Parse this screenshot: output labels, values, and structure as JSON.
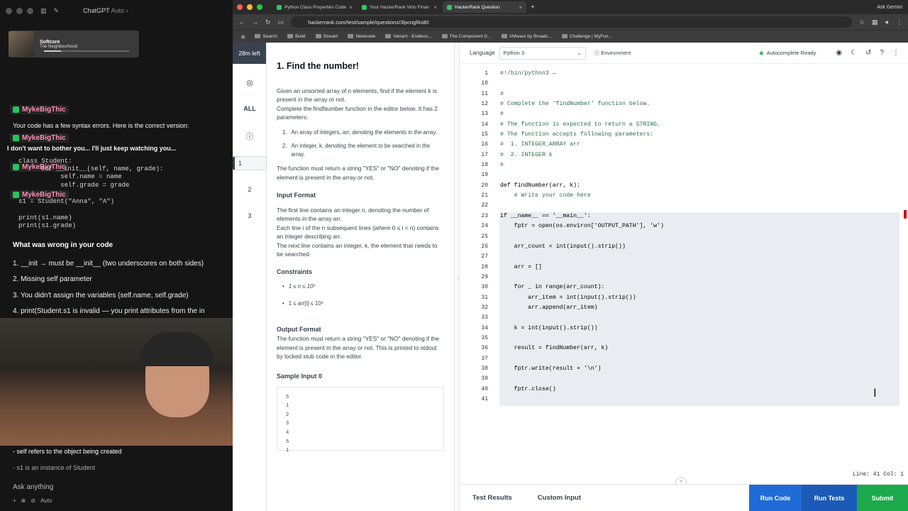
{
  "chatgpt": {
    "title": "ChatGPT",
    "title_suffix": "Auto ›",
    "now_playing": {
      "track": "Softcore",
      "artist": "The Neighbourhood"
    },
    "messages": [
      {
        "user": "MykeBigThic",
        "text": "Your code has a few syntax errors. Here is the correct version:"
      },
      {
        "user": "MykeBigThic",
        "text": "I don't want to bother you... I'll just keep watching you..."
      },
      {
        "user": "MykeBigThic",
        "text": ""
      },
      {
        "user": "MykeBigThic",
        "text": ""
      }
    ],
    "code_lines": [
      "class Student:",
      "    def __init__(self, name, grade):",
      "        self.name = name",
      "        self.grade = grade",
      "s1 = Student(\"Anna\", \"A\")",
      "print(s1.name)",
      "print(s1.grade)"
    ],
    "heading": "What was wrong in your code",
    "points": [
      "1. __init → must be __init__ (two underscores on both sides)",
      "2. Missing self parameter",
      "3. You didn't assign the variables (self.name, self.grade)",
      "4. print(Student.s1 is invalid — you print attributes from the in"
    ],
    "bottom_lines": [
      "- self refers to the object being created",
      "- s1 is an instance of Student"
    ],
    "ask_placeholder": "Ask anything",
    "ask_tools": [
      "+",
      "⊕",
      "⊘",
      "Auto"
    ]
  },
  "browser": {
    "tabs": [
      {
        "label": "Python Class Properties Code",
        "active": false
      },
      {
        "label": "Your HackerRank Virtu Finan",
        "active": false
      },
      {
        "label": "HackerRank Question",
        "active": true
      }
    ],
    "ask_gemini": "Ask Gemini",
    "url": "hackerrank.com/test/sample/questions/3lpcngf4s80",
    "bookmarks": [
      "Search",
      "Build",
      "Stream",
      "Neetcode",
      "Variant - Endless...",
      "The Component G...",
      "VMware by Broadc...",
      "Challenge | MyFun..."
    ]
  },
  "hr": {
    "timer": "28m left",
    "rail": [
      "ALL",
      "1",
      "2",
      "3"
    ],
    "title": "1. Find the number!",
    "intro": "Given an unsorted array of n elements, find if the element k is present in the array or not.",
    "intro2": "Complete the findNumber function in the editor below. It has 2 parameters:",
    "params": [
      {
        "n": "1.",
        "t": "An array of integers, arr, denoting the elements in the array."
      },
      {
        "n": "2.",
        "t": "An integer, k, denoting the element to be searched in the array."
      }
    ],
    "returns": "The function must return a string \"YES\" or \"NO\" denoting if the element is present in the array or not.",
    "input_h": "Input Format",
    "input_1": "The first line contains an integer n, denoting the number of elements in the array arr.",
    "input_2": "Each line i of the n subsequent lines (where 0 ≤ i < n) contains an integer describing arr.",
    "input_3": "The next line contains an integer, k, the element that needs to be searched.",
    "constraints_h": "Constraints",
    "constraints": [
      "1 ≤ n ≤ 10⁵",
      "1 ≤ arr[i] ≤ 10⁹"
    ],
    "output_h": "Output Format",
    "output": "The function must return a string \"YES\" or \"NO\" denoting if the element is present in the array or not. This is printed to stdout by locked stub code in the editor.",
    "sample_h": "Sample Input 0",
    "sample": [
      "5",
      "1",
      "2",
      "3",
      "4",
      "5",
      "1"
    ]
  },
  "editor": {
    "language_label": "Language",
    "language": "Python 3",
    "environment": "Environment",
    "autocomplete": "Autocomplete Ready",
    "status": "Line: 41  Col: 1",
    "tabs": [
      "Test Results",
      "Custom Input"
    ],
    "buttons": {
      "run": "Run Code",
      "tests": "Run Tests",
      "submit": "Submit"
    },
    "lines": [
      {
        "n": "1",
        "t": "#!/bin/python3 ↔",
        "c": "cm"
      },
      {
        "n": "10",
        "t": "",
        "c": ""
      },
      {
        "n": "11",
        "t": "#",
        "c": "cm"
      },
      {
        "n": "12",
        "t": "# Complete the 'findNumber' function below.",
        "c": "cm"
      },
      {
        "n": "13",
        "t": "#",
        "c": "cm"
      },
      {
        "n": "14",
        "t": "# The function is expected to return a STRING.",
        "c": "cm"
      },
      {
        "n": "15",
        "t": "# The function accepts following parameters:",
        "c": "cm"
      },
      {
        "n": "16",
        "t": "#  1. INTEGER_ARRAY arr",
        "c": "cm"
      },
      {
        "n": "17",
        "t": "#  2. INTEGER k",
        "c": "cm"
      },
      {
        "n": "18",
        "t": "#",
        "c": "cm"
      },
      {
        "n": "19",
        "t": "",
        "c": ""
      },
      {
        "n": "20",
        "t": "def findNumber(arr, k):",
        "c": ""
      },
      {
        "n": "21",
        "t": "    # Write your code here",
        "c": "cm"
      },
      {
        "n": "22",
        "t": "",
        "c": ""
      },
      {
        "n": "23",
        "t": "if __name__ == '__main__':",
        "c": ""
      },
      {
        "n": "24",
        "t": "    fptr = open(os.environ['OUTPUT_PATH'], 'w')",
        "c": ""
      },
      {
        "n": "25",
        "t": "",
        "c": ""
      },
      {
        "n": "26",
        "t": "    arr_count = int(input().strip())",
        "c": ""
      },
      {
        "n": "27",
        "t": "",
        "c": ""
      },
      {
        "n": "28",
        "t": "    arr = []",
        "c": ""
      },
      {
        "n": "29",
        "t": "",
        "c": ""
      },
      {
        "n": "30",
        "t": "    for _ in range(arr_count):",
        "c": ""
      },
      {
        "n": "31",
        "t": "        arr_item = int(input().strip())",
        "c": ""
      },
      {
        "n": "32",
        "t": "        arr.append(arr_item)",
        "c": ""
      },
      {
        "n": "33",
        "t": "",
        "c": ""
      },
      {
        "n": "34",
        "t": "    k = int(input().strip())",
        "c": ""
      },
      {
        "n": "35",
        "t": "",
        "c": ""
      },
      {
        "n": "36",
        "t": "    result = findNumber(arr, k)",
        "c": ""
      },
      {
        "n": "37",
        "t": "",
        "c": ""
      },
      {
        "n": "38",
        "t": "    fptr.write(result + '\\n')",
        "c": ""
      },
      {
        "n": "39",
        "t": "",
        "c": ""
      },
      {
        "n": "40",
        "t": "    fptr.close()",
        "c": ""
      },
      {
        "n": "41",
        "t": "",
        "c": ""
      }
    ]
  }
}
